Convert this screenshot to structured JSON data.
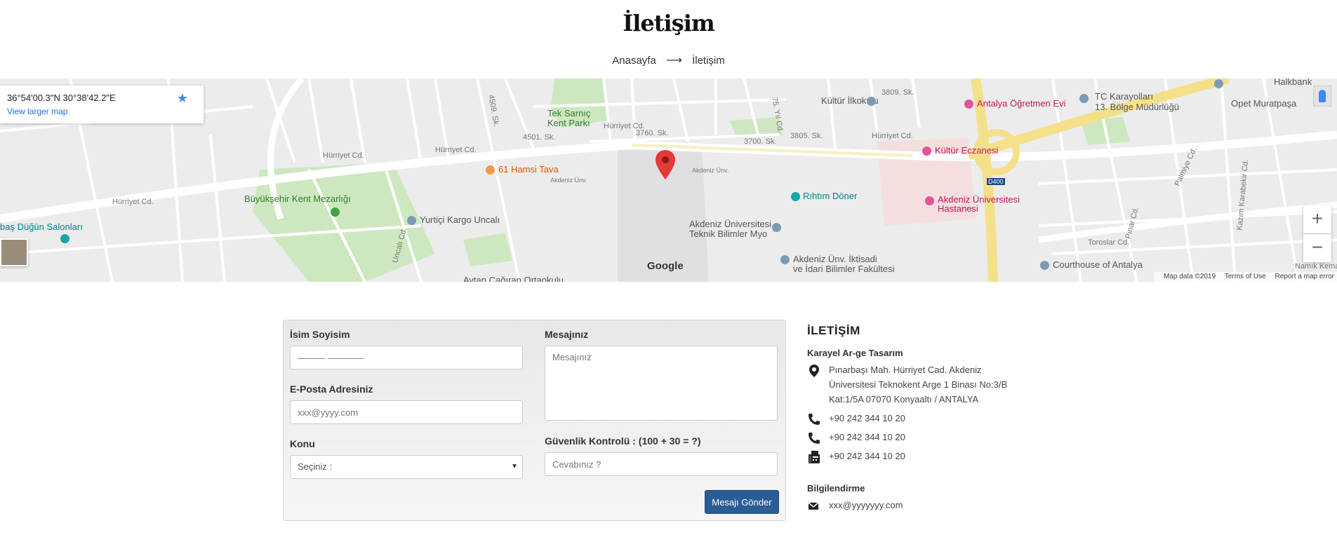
{
  "header": {
    "title": "İletişim",
    "breadcrumb": {
      "home": "Anasayfa",
      "separator": "⟶",
      "current": "İletişim"
    }
  },
  "map": {
    "coords": "36°54'00.3\"N 30°38'42.2\"E",
    "view_larger": "View larger map",
    "footer": {
      "data": "Map data ©2019",
      "terms": "Terms of Use",
      "report": "Report a map error"
    },
    "logo": "Google",
    "labels": {
      "kultur_ilkokulu": "Kültür İlkokulu",
      "ogretmen_evi": "Antalya Öğretmen Evi",
      "tc_karayollari_1": "TC Karayolları",
      "tc_karayollari_2": "13. Bölge Müdürlüğü",
      "opet": "Opet Muratpaşa",
      "halkbank": "Halkbank",
      "tek_sarnic_1": "Tek Sarnıç",
      "tek_sarnic_2": "Kent Parkı",
      "hamsi_tava": "61 Hamsi Tava",
      "kultur_eczanesi": "Kültür Eczanesi",
      "ritim_doner": "Rıhtım Döner",
      "akdeniz_hastanesi_1": "Akdeniz Üniversitesi",
      "akdeniz_hastanesi_2": "Hastanesi",
      "kent_mezarligi": "Büyükşehir Kent Mezarlığı",
      "yurtici": "Yurtiçi Kargo Uncalı",
      "dugun": "baş Düğün Salonları",
      "teknik_1": "Akdeniz Üniversitesi",
      "teknik_2": "Teknik Bilimler Myo",
      "iktisadi_1": "Akdeniz Ünv. İktisadi",
      "iktisadi_2": "ve İdari Bilimler Fakültesi",
      "courthouse": "Courthouse of Antalya",
      "ortaokul": "Aytan Çağıran Ortaokulu",
      "hurriyet_1": "Hürriyet Cd.",
      "hurriyet_2": "Hürriyet Cd.",
      "hurriyet_3": "Hürriyet Cd.",
      "hurriyet_4": "Hürriyet Cd.",
      "hurriyet_5": "Hürriyet Cd.",
      "toroslar": "Toroslar Cd.",
      "d400": "D400",
      "yil_75": "75. Yıl Cd.",
      "uncali": "Uncalı Cd.",
      "pinar": "Pınar Cd.",
      "palmiye": "Palmiye Cd.",
      "kazim": "Kazım Karabekir Cd.",
      "namik": "Namık Kema",
      "sk_4509": "4509. Sk.",
      "sk_4501": "4501. Sk.",
      "sk_3760": "3760. Sk.",
      "sk_3700": "3700. Sk.",
      "sk_3805": "3805. Sk.",
      "sk_3809": "3809. Sk.",
      "akdeniz_unv": "Akdeniz Ünv.",
      "akdeniz_unv_2": "Akdeniz Ünv."
    }
  },
  "form": {
    "name_label": "İsim Soyisim",
    "name_placeholder": "——— ————",
    "email_label": "E-Posta Adresiniz",
    "email_placeholder": "xxx@yyyy.com",
    "subject_label": "Konu",
    "subject_selected": "Seçiniz :",
    "message_label": "Mesajınız",
    "message_placeholder": "Mesajınız",
    "captcha_label": "Güvenlik Kontrolü : (100 + 30 = ?)",
    "captcha_placeholder": "Cevabınız ?",
    "submit_label": "Mesajı Gönder"
  },
  "contact": {
    "heading": "İLETİŞİM",
    "company": "Karayel Ar-ge Tasarım",
    "address": "Pınarbaşı Mah. Hürriyet Cad. Akdeniz Üniversitesi Teknokent Arge 1 Binası No:3/B Kat:1/5A 07070 Konyaaltı / ANTALYA",
    "phone1": "+90 242 344 10 20",
    "phone2": "+90 242 344 10 20",
    "fax": "+90 242 344 10 20",
    "info_heading": "Bilgilendirme",
    "email": "xxx@yyyyyyy.com"
  },
  "colors": {
    "accent": "#2a5d96",
    "link": "#1a73e8",
    "pin": "#e53935"
  }
}
